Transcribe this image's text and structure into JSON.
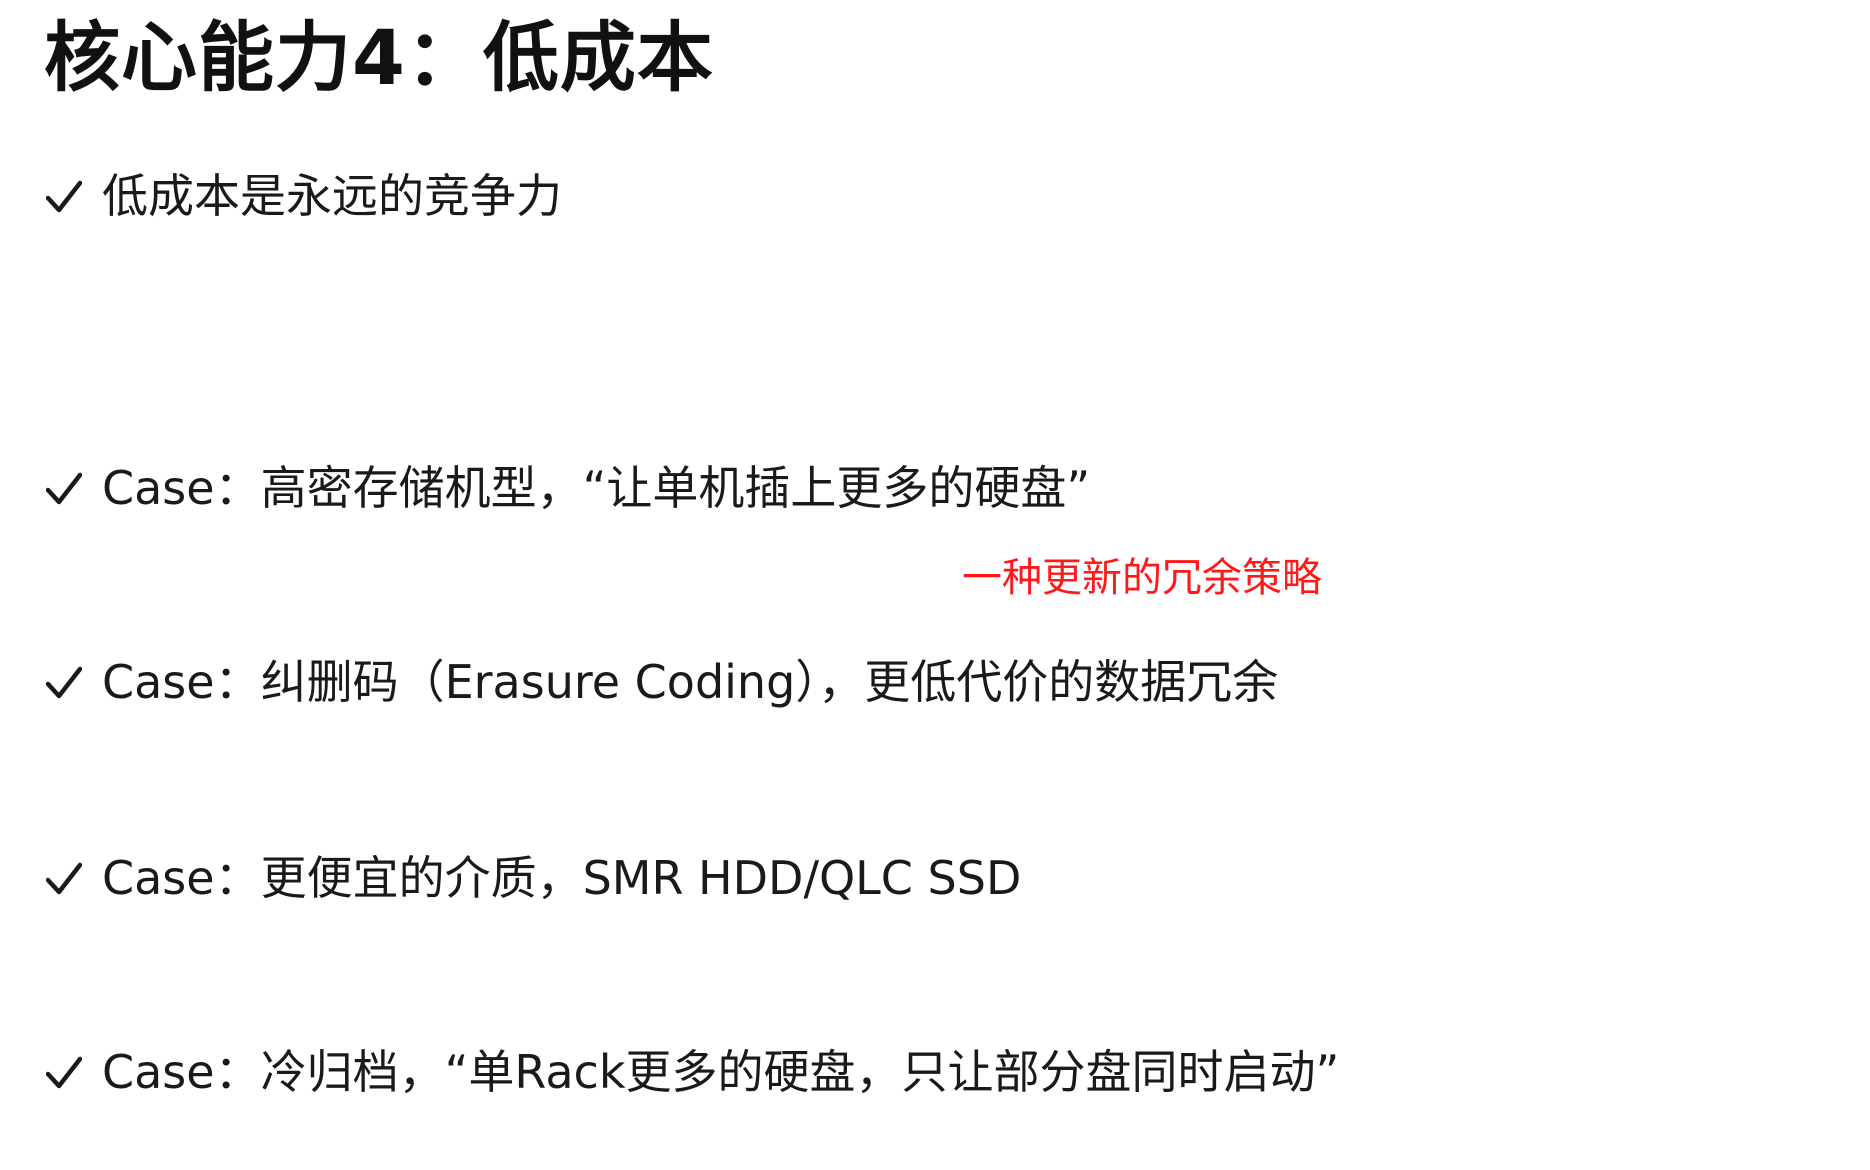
{
  "slide": {
    "title": "核心能力4：低成本",
    "bullets": [
      {
        "text": "低成本是永远的竞争力"
      },
      {
        "text": "Case：高密存储机型，“让单机插上更多的硬盘”"
      },
      {
        "text": "Case：纠删码（Erasure Coding），更低代价的数据冗余"
      },
      {
        "text": "Case：更便宜的介质，SMR HDD/QLC SSD"
      },
      {
        "text": "Case：冷归档，“单Rack更多的硬盘，只让部分盘同时启动”"
      }
    ],
    "annotation": "一种更新的冗余策略",
    "colors": {
      "text": "#1a1a1a",
      "annotation": "#ff1a1a"
    },
    "icon": "checkmark-icon"
  }
}
